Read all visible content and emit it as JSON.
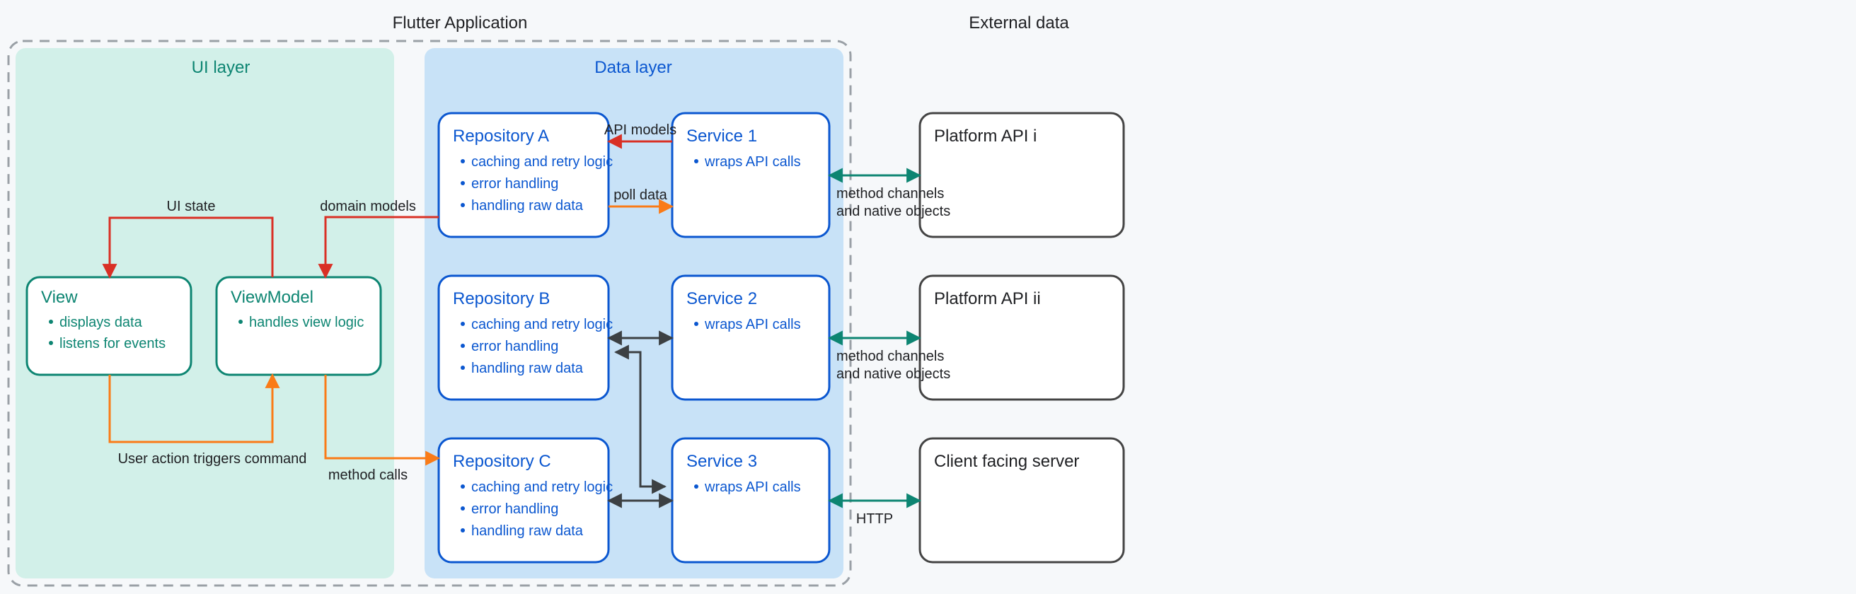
{
  "diagram": {
    "app_title": "Flutter Application",
    "external_title": "External data",
    "ui_layer": {
      "title": "UI layer",
      "view": {
        "title": "View",
        "bullets": [
          "displays data",
          "listens for events"
        ]
      },
      "viewmodel": {
        "title": "ViewModel",
        "bullets": [
          "handles view logic"
        ]
      },
      "arrow_ui_state": "UI state",
      "arrow_user_action": "User action triggers command",
      "arrow_domain_models": "domain models",
      "arrow_method_calls": "method calls"
    },
    "data_layer": {
      "title": "Data layer",
      "repositories": [
        {
          "title": "Repository A",
          "bullets": [
            "caching and retry logic",
            "error handling",
            "handling raw data"
          ]
        },
        {
          "title": "Repository B",
          "bullets": [
            "caching and retry logic",
            "error handling",
            "handling raw data"
          ]
        },
        {
          "title": "Repository C",
          "bullets": [
            "caching and retry logic",
            "error handling",
            "handling raw data"
          ]
        }
      ],
      "services": [
        {
          "title": "Service 1",
          "bullets": [
            "wraps API calls"
          ]
        },
        {
          "title": "Service 2",
          "bullets": [
            "wraps API calls"
          ]
        },
        {
          "title": "Service 3",
          "bullets": [
            "wraps API calls"
          ]
        }
      ],
      "arrow_api_models": "API models",
      "arrow_poll_data": "poll data"
    },
    "external": [
      {
        "title": "Platform API i",
        "label1": "method channels",
        "label2": "and native objects"
      },
      {
        "title": "Platform API ii",
        "label1": "method channels",
        "label2": "and native objects"
      },
      {
        "title": "Client facing server",
        "label1": "HTTP",
        "label2": ""
      }
    ],
    "colors": {
      "teal": "#0d8572",
      "tealFill": "#d2f0e9",
      "blue": "#0b57d0",
      "blueFill": "#c8e2f7",
      "red": "#d93025",
      "orange": "#fa7b17",
      "dark": "#3c4043",
      "boxStrokeGrey": "#444"
    }
  }
}
